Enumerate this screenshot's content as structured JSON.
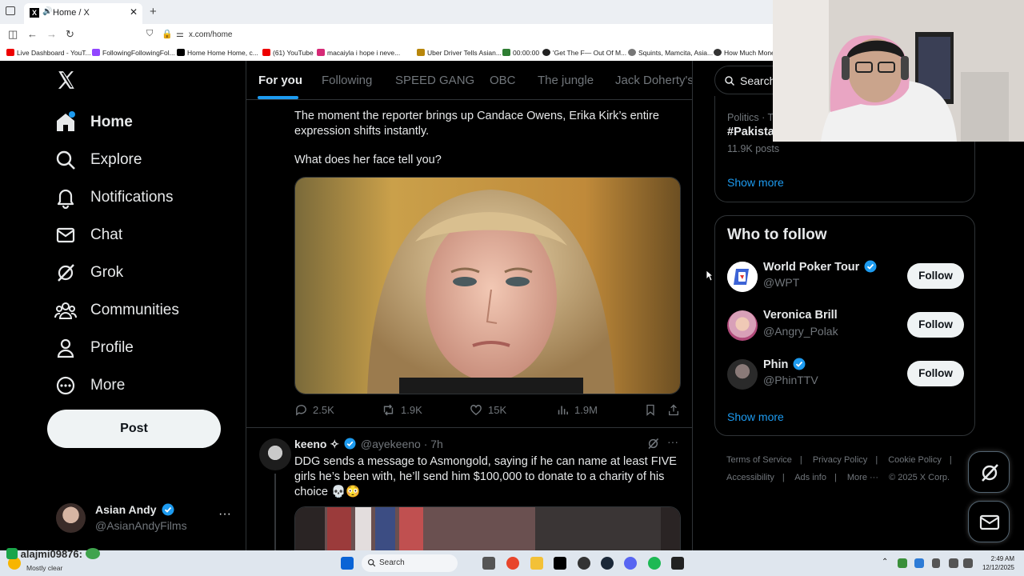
{
  "browser": {
    "tab_title": "Home / X",
    "url": "x.com/home",
    "bookmarks": [
      "Live Dashboard - YouT...",
      "FollowingFollowingFol...",
      "Home Home Home, c...",
      "(61) YouTube",
      "macaiyla i hope i neve...",
      "Uber Driver Tells Asian...",
      "00:00:00",
      "'Get The F— Out Of M...",
      "Squints, Mamcita, Asia...",
      "How Much Mone"
    ]
  },
  "nav": {
    "items": [
      {
        "label": "Home",
        "icon": "home-icon"
      },
      {
        "label": "Explore",
        "icon": "search-icon"
      },
      {
        "label": "Notifications",
        "icon": "bell-icon"
      },
      {
        "label": "Chat",
        "icon": "mail-icon"
      },
      {
        "label": "Grok",
        "icon": "grok-icon"
      },
      {
        "label": "Communities",
        "icon": "people-icon"
      },
      {
        "label": "Profile",
        "icon": "person-icon"
      },
      {
        "label": "More",
        "icon": "more-circle-icon"
      }
    ],
    "post_label": "Post",
    "account": {
      "name": "Asian Andy",
      "handle": "@AsianAndyFilms"
    }
  },
  "timeline": {
    "tabs": [
      "For you",
      "Following",
      "SPEED GANG",
      "OBC",
      "The jungle",
      "Jack Doherty's"
    ],
    "tweet1": {
      "text_line1": "The moment the reporter brings up Candace Owens, Erika Kirk’s entire expression shifts instantly.",
      "text_line2": "What does her face tell you?",
      "replies": "2.5K",
      "reposts": "1.9K",
      "likes": "15K",
      "views": "1.9M"
    },
    "tweet2": {
      "name": "keeno ✧",
      "handle": "@ayekeeno",
      "time": "· 7h",
      "text": "DDG sends a message to Asmongold, saying if he can name at least FIVE girls he’s been with, he’ll send him $100,000 to donate to a charity of his choice 💀😳"
    }
  },
  "sidebar": {
    "search_placeholder": "Search",
    "trend": {
      "category": "Politics · T",
      "name": "#Pakista",
      "posts": "11.9K posts"
    },
    "show_more": "Show more",
    "who_to_follow_title": "Who to follow",
    "who_to_follow": [
      {
        "name": "World Poker Tour",
        "handle": "@WPT",
        "verified": true,
        "follow": "Follow"
      },
      {
        "name": "Veronica Brill",
        "handle": "@Angry_Polak",
        "verified": false,
        "follow": "Follow"
      },
      {
        "name": "Phin",
        "handle": "@PhinTTV",
        "verified": true,
        "follow": "Follow"
      }
    ],
    "footer": [
      "Terms of Service",
      "|",
      "Privacy Policy",
      "|",
      "Cookie Policy",
      "|",
      "Accessibility",
      "|",
      "Ads info",
      "|",
      "More ···",
      "© 2025 X Corp."
    ]
  },
  "taskbar": {
    "search": "Search",
    "weather": "Mostly clear",
    "time": "2:49 AM",
    "date": "12/12/2025"
  },
  "overlay": {
    "chat_text": "alajmi09876:"
  },
  "colors": {
    "accent": "#1d9bf0",
    "bg": "#000000",
    "muted": "#71767b",
    "border": "#2f3336"
  }
}
